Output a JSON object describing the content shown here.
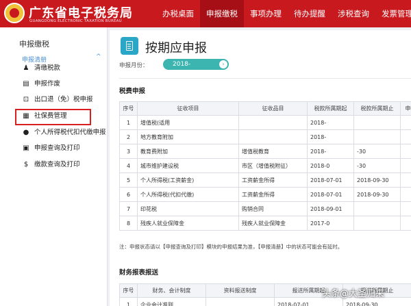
{
  "header": {
    "title": "广东省电子税务局",
    "subtitle": "GUANGDONG ELECTRONIC TAXATION BUREAU",
    "nav": [
      "办税桌面",
      "申报缴税",
      "事项办理",
      "待办提醒",
      "涉税查询",
      "发票管理"
    ],
    "active_nav": "申报缴税",
    "brand_color": "#c8191f"
  },
  "sidebar": {
    "title": "申报缴税",
    "group": "申报清册",
    "items": [
      {
        "label": "清缴税款",
        "icon": "money-bag-icon"
      },
      {
        "label": "申报作废",
        "icon": "document-icon"
      },
      {
        "label": "出口退（免）税申报",
        "icon": "export-icon"
      },
      {
        "label": "社保费管理",
        "icon": "social-insurance-icon"
      },
      {
        "label": "个人所得税代扣代缴申报",
        "icon": "person-icon"
      },
      {
        "label": "申报查询及打印",
        "icon": "search-doc-icon"
      },
      {
        "label": "缴款查询及打印",
        "icon": "coin-icon"
      }
    ],
    "highlight_color": "#d81e1e"
  },
  "main": {
    "title": "按期应申报",
    "period_label": "申报月份：",
    "period_value": "2018-",
    "tax_section": "税费申报",
    "tax_headers": [
      "序号",
      "征收项目",
      "征收品目",
      "税款所属期起",
      "税款所属期止",
      "申报"
    ],
    "tax_rows": [
      [
        "1",
        "增值税(适用",
        "",
        "2018-",
        "",
        ""
      ],
      [
        "2",
        "地方教育附加",
        "",
        "2018-",
        "",
        ""
      ],
      [
        "3",
        "教育费附加",
        "增值税教育",
        "2018-",
        "-30",
        ""
      ],
      [
        "4",
        "城市维护建设税",
        "市区（增值税附征）",
        "2018-0",
        "-30",
        ""
      ],
      [
        "5",
        "个人所得税(工资薪金)",
        "工资薪金所得",
        "2018-07-01",
        "2018-09-30",
        ""
      ],
      [
        "6",
        "个人所得税(代扣代缴)",
        "工资薪金所得",
        "2018-07-01",
        "2018-09-30",
        ""
      ],
      [
        "7",
        "印花税",
        "购销合同",
        "2018-09-01",
        "",
        ""
      ],
      [
        "8",
        "残疾人就业保障金",
        "残疾人就业保障金",
        "2017-0",
        "",
        ""
      ]
    ],
    "note": "注：申报状态请以【申报查询及打印】模块的申报结果为准，【申报清册】中的状态可能会有延时。",
    "finance_section": "财务报表报送",
    "finance_headers": [
      "序号",
      "财务、会计制度",
      "资料报送制度",
      "报送所属期起",
      "报送所属期止"
    ],
    "finance_rows": [
      [
        "1",
        "企业会计准则",
        "",
        "2018-07-01",
        "2018-09-30"
      ]
    ],
    "accent_color": "#2aa6c7"
  },
  "watermark": "头条@大圣归来"
}
